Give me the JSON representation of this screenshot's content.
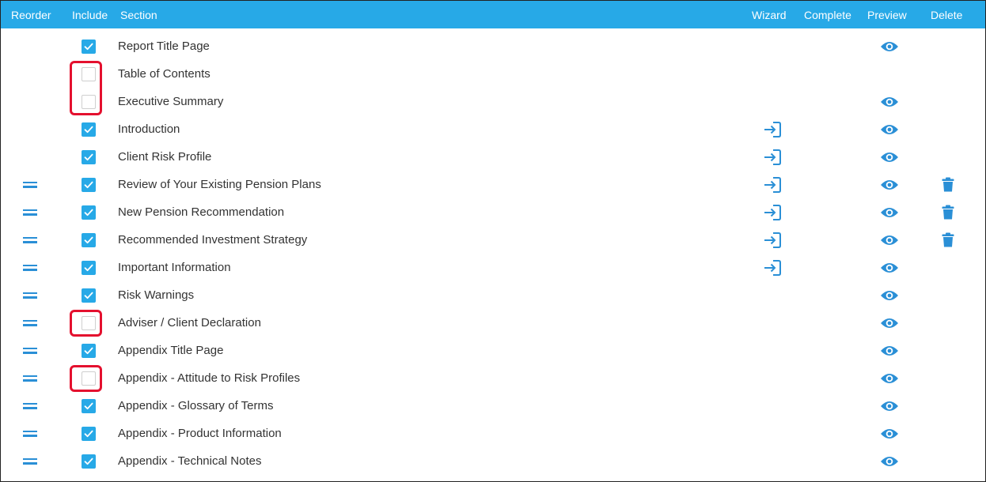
{
  "header": {
    "reorder": "Reorder",
    "include": "Include",
    "section": "Section",
    "wizard": "Wizard",
    "complete": "Complete",
    "preview": "Preview",
    "delete": "Delete"
  },
  "colors": {
    "header_bg": "#27a9e7",
    "accent": "#2a8fd6",
    "highlight": "#e4102e"
  },
  "icons": {
    "reorder": "drag-handle-icon",
    "wizard": "sign-in-icon",
    "preview": "eye-icon",
    "delete": "trash-icon"
  },
  "sections": [
    {
      "label": "Report Title Page",
      "included": true,
      "reorder": false,
      "wizard": false,
      "preview": true,
      "delete": false
    },
    {
      "label": "Table of Contents",
      "included": false,
      "reorder": false,
      "wizard": false,
      "preview": false,
      "delete": false
    },
    {
      "label": "Executive Summary",
      "included": false,
      "reorder": false,
      "wizard": false,
      "preview": true,
      "delete": false
    },
    {
      "label": "Introduction",
      "included": true,
      "reorder": false,
      "wizard": true,
      "preview": true,
      "delete": false
    },
    {
      "label": "Client Risk Profile",
      "included": true,
      "reorder": false,
      "wizard": true,
      "preview": true,
      "delete": false
    },
    {
      "label": "Review of Your Existing Pension Plans",
      "included": true,
      "reorder": true,
      "wizard": true,
      "preview": true,
      "delete": true
    },
    {
      "label": "New Pension Recommendation",
      "included": true,
      "reorder": true,
      "wizard": true,
      "preview": true,
      "delete": true
    },
    {
      "label": "Recommended Investment Strategy",
      "included": true,
      "reorder": true,
      "wizard": true,
      "preview": true,
      "delete": true
    },
    {
      "label": "Important Information",
      "included": true,
      "reorder": true,
      "wizard": true,
      "preview": true,
      "delete": false
    },
    {
      "label": "Risk Warnings",
      "included": true,
      "reorder": true,
      "wizard": false,
      "preview": true,
      "delete": false
    },
    {
      "label": "Adviser / Client Declaration",
      "included": false,
      "reorder": true,
      "wizard": false,
      "preview": true,
      "delete": false
    },
    {
      "label": "Appendix Title Page",
      "included": true,
      "reorder": true,
      "wizard": false,
      "preview": true,
      "delete": false
    },
    {
      "label": "Appendix - Attitude to Risk Profiles",
      "included": false,
      "reorder": true,
      "wizard": false,
      "preview": true,
      "delete": false
    },
    {
      "label": "Appendix - Glossary of Terms",
      "included": true,
      "reorder": true,
      "wizard": false,
      "preview": true,
      "delete": false
    },
    {
      "label": "Appendix - Product Information",
      "included": true,
      "reorder": true,
      "wizard": false,
      "preview": true,
      "delete": false
    },
    {
      "label": "Appendix - Technical Notes",
      "included": true,
      "reorder": true,
      "wizard": false,
      "preview": true,
      "delete": false
    }
  ]
}
